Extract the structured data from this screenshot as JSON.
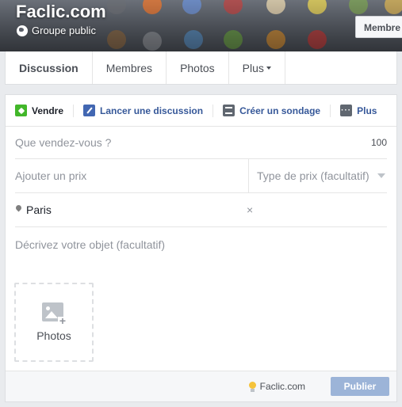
{
  "group": {
    "title": "Faclic.com",
    "privacy": "Groupe public",
    "member_button": "Membre"
  },
  "tabs": [
    {
      "label": "Discussion",
      "active": true
    },
    {
      "label": "Membres"
    },
    {
      "label": "Photos"
    },
    {
      "label": "Plus"
    }
  ],
  "composer": {
    "actions": [
      {
        "label": "Vendre",
        "icon": "sell-tag-icon",
        "active": true
      },
      {
        "label": "Lancer une discussion",
        "icon": "pencil-icon"
      },
      {
        "label": "Créer un sondage",
        "icon": "poll-icon"
      },
      {
        "label": "Plus",
        "icon": "more-dots-icon"
      }
    ],
    "what_placeholder": "Que vendez-vous ?",
    "char_count": "100",
    "price_placeholder": "Ajouter un prix",
    "price_type_placeholder": "Type de prix (facultatif)",
    "location_value": "Paris",
    "location_clear": "×",
    "description_placeholder": "Décrivez votre objet (facultatif)",
    "photos_label": "Photos",
    "footer_site": "Faclic.com",
    "publish_label": "Publier"
  },
  "colors": {
    "brand_blue": "#4267b2",
    "link_blue": "#365899",
    "sell_green": "#42b72a",
    "publish_disabled": "#9cb4d8"
  }
}
